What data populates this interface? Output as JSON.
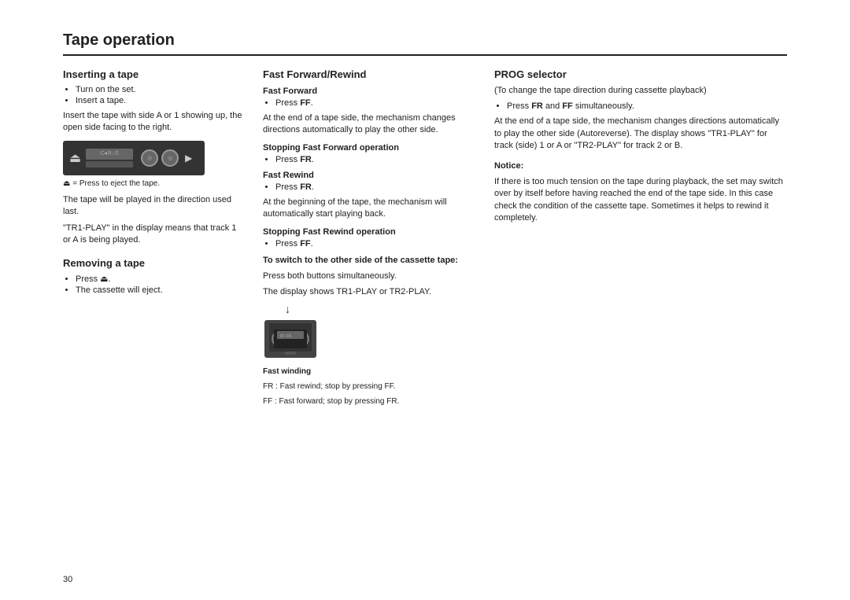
{
  "page": {
    "title": "Tape operation",
    "page_number": "30"
  },
  "inserting": {
    "title": "Inserting a tape",
    "bullets": [
      "Turn on the set.",
      "Insert a tape."
    ],
    "note1": "Insert the tape with side A or 1 showing up, the open side facing to the right.",
    "eject_note": "⏏ = Press to eject the tape.",
    "note2": "The tape will be played in the direction used last.",
    "note3": "\"TR1-PLAY\" in the display means that track 1 or A is being played."
  },
  "removing": {
    "title": "Removing a tape",
    "bullet1": "Press ⏏.",
    "bullet2": "The cassette will eject."
  },
  "fastforward": {
    "title": "Fast Forward/Rewind",
    "ff_title": "Fast Forward",
    "ff_bullet": "Press FF.",
    "ff_note": "At the end of a tape side, the mechanism changes directions automatically to play the other side.",
    "stop_ff_title": "Stopping Fast Forward operation",
    "stop_ff_bullet": "Press FR.",
    "fr_title": "Fast Rewind",
    "fr_bullet": "Press FR.",
    "fr_note": "At the beginning of the tape, the mechanism will automatically start playing back.",
    "stop_fr_title": "Stopping Fast Rewind operation",
    "stop_fr_bullet": "Press FF.",
    "switch_title": "To switch to the other side of the cassette tape:",
    "switch_note1": "Press both buttons simultaneously.",
    "switch_note2": "The display shows TR1-PLAY or TR2-PLAY.",
    "fast_winding_title": "Fast winding",
    "fast_winding_fr": "FR : Fast rewind; stop by pressing FF.",
    "fast_winding_ff": "FF : Fast forward; stop by pressing FR."
  },
  "prog": {
    "title": "PROG selector",
    "subtitle": "(To change the tape direction during cassette playback)",
    "bullet": "Press FR and FF simultaneously.",
    "note": "At the end of a tape side, the mechanism changes directions automatically to play the other side (Autoreverse). The display shows \"TR1-PLAY\" for track (side) 1 or A or \"TR2-PLAY\" for track 2 or B.",
    "notice_title": "Notice:",
    "notice_text": "If there is too much tension on the tape during playback, the set may switch over by itself before having reached the end of the tape side. In this case check the condition of the cassette tape. Sometimes it helps to rewind it completely."
  }
}
